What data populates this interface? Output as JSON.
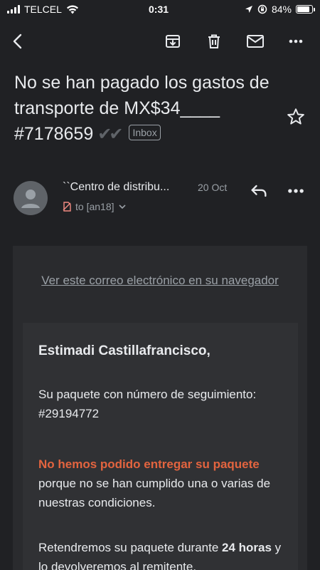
{
  "status_bar": {
    "carrier": "TELCEL",
    "time": "0:31",
    "battery_percent": "84%",
    "battery_level": 0.84
  },
  "toolbar": {
    "back": "back-icon",
    "archive": "archive-icon",
    "delete": "trash-icon",
    "mark_unread": "mail-icon",
    "more": "more-icon"
  },
  "email": {
    "subject": "No se han pagado los gastos de transporte de MX$34____ #7178659",
    "subject_ticks": "✔✔",
    "label": "Inbox",
    "sender_name": "``Centro de distribu...",
    "date": "20 Oct",
    "recipient": "to [an18]"
  },
  "body": {
    "view_link": "Ver este correo electrónico en su navegador",
    "greeting": "Estimadi Castillafrancisco,",
    "p1": "Su paquete con número de seguimiento: #29194772",
    "p2_alert": "No hemos podido entregar su paquete",
    "p2_rest": " porque no se han cumplido una o varias de nuestras condiciones.",
    "p3_start": "Retendremos su paquete durante ",
    "p3_bold": "24 horas",
    "p3_end": " y lo devolveremos al remitente."
  },
  "colors": {
    "background": "#202124",
    "alert": "#e3643f",
    "muted": "#9aa0a6"
  }
}
